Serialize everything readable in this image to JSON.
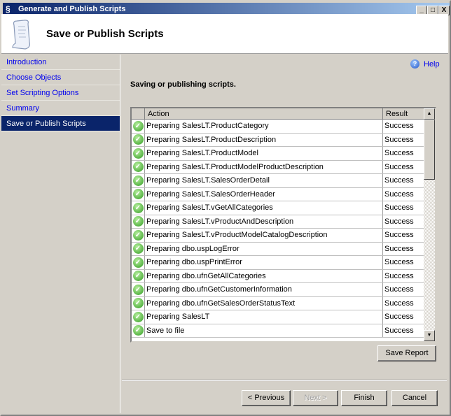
{
  "window": {
    "title": "Generate and Publish Scripts",
    "controls": [
      "_",
      "□",
      "X"
    ]
  },
  "header": {
    "title": "Save or Publish Scripts"
  },
  "nav": {
    "items": [
      {
        "label": "Introduction"
      },
      {
        "label": "Choose Objects"
      },
      {
        "label": "Set Scripting Options"
      },
      {
        "label": "Summary"
      },
      {
        "label": "Save or Publish Scripts",
        "active": true
      }
    ]
  },
  "help": {
    "label": "Help"
  },
  "main": {
    "subtitle": "Saving or publishing scripts."
  },
  "grid": {
    "columns": [
      "Action",
      "Result"
    ],
    "rows": [
      {
        "action": "Preparing SalesLT.ProductCategory",
        "result": "Success"
      },
      {
        "action": "Preparing SalesLT.ProductDescription",
        "result": "Success"
      },
      {
        "action": "Preparing SalesLT.ProductModel",
        "result": "Success"
      },
      {
        "action": "Preparing SalesLT.ProductModelProductDescription",
        "result": "Success"
      },
      {
        "action": "Preparing SalesLT.SalesOrderDetail",
        "result": "Success"
      },
      {
        "action": "Preparing SalesLT.SalesOrderHeader",
        "result": "Success"
      },
      {
        "action": "Preparing SalesLT.vGetAllCategories",
        "result": "Success"
      },
      {
        "action": "Preparing SalesLT.vProductAndDescription",
        "result": "Success"
      },
      {
        "action": "Preparing SalesLT.vProductModelCatalogDescription",
        "result": "Success"
      },
      {
        "action": "Preparing dbo.uspLogError",
        "result": "Success"
      },
      {
        "action": "Preparing dbo.uspPrintError",
        "result": "Success"
      },
      {
        "action": "Preparing dbo.ufnGetAllCategories",
        "result": "Success"
      },
      {
        "action": "Preparing dbo.ufnGetCustomerInformation",
        "result": "Success"
      },
      {
        "action": "Preparing dbo.ufnGetSalesOrderStatusText",
        "result": "Success"
      },
      {
        "action": "Preparing SalesLT",
        "result": "Success"
      },
      {
        "action": "Save to file",
        "result": "Success"
      }
    ]
  },
  "buttons": {
    "save_report": "Save Report",
    "previous": "< Previous",
    "next": "Next >",
    "finish": "Finish",
    "cancel": "Cancel"
  }
}
